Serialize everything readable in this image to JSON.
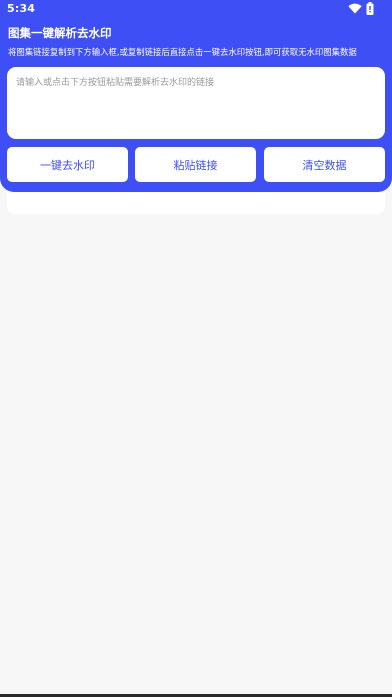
{
  "status_bar": {
    "time": "5:34",
    "icons": [
      "wifi-icon",
      "battery-icon"
    ]
  },
  "header": {
    "title": "图集一键解析去水印",
    "subtitle": "将图集链接复制到下方输入框,或复制链接后直接点击一键去水印按钮,即可获取无水印图集数据"
  },
  "input": {
    "value": "",
    "placeholder": "请输入或点击下方按钮粘贴需要解析去水印的链接"
  },
  "buttons": {
    "remove_watermark": "一键去水印",
    "paste_link": "粘贴链接",
    "clear_data": "清空数据"
  },
  "colors": {
    "accent": "#3d4ff5",
    "background": "#f7f7f7",
    "card": "#ffffff"
  }
}
